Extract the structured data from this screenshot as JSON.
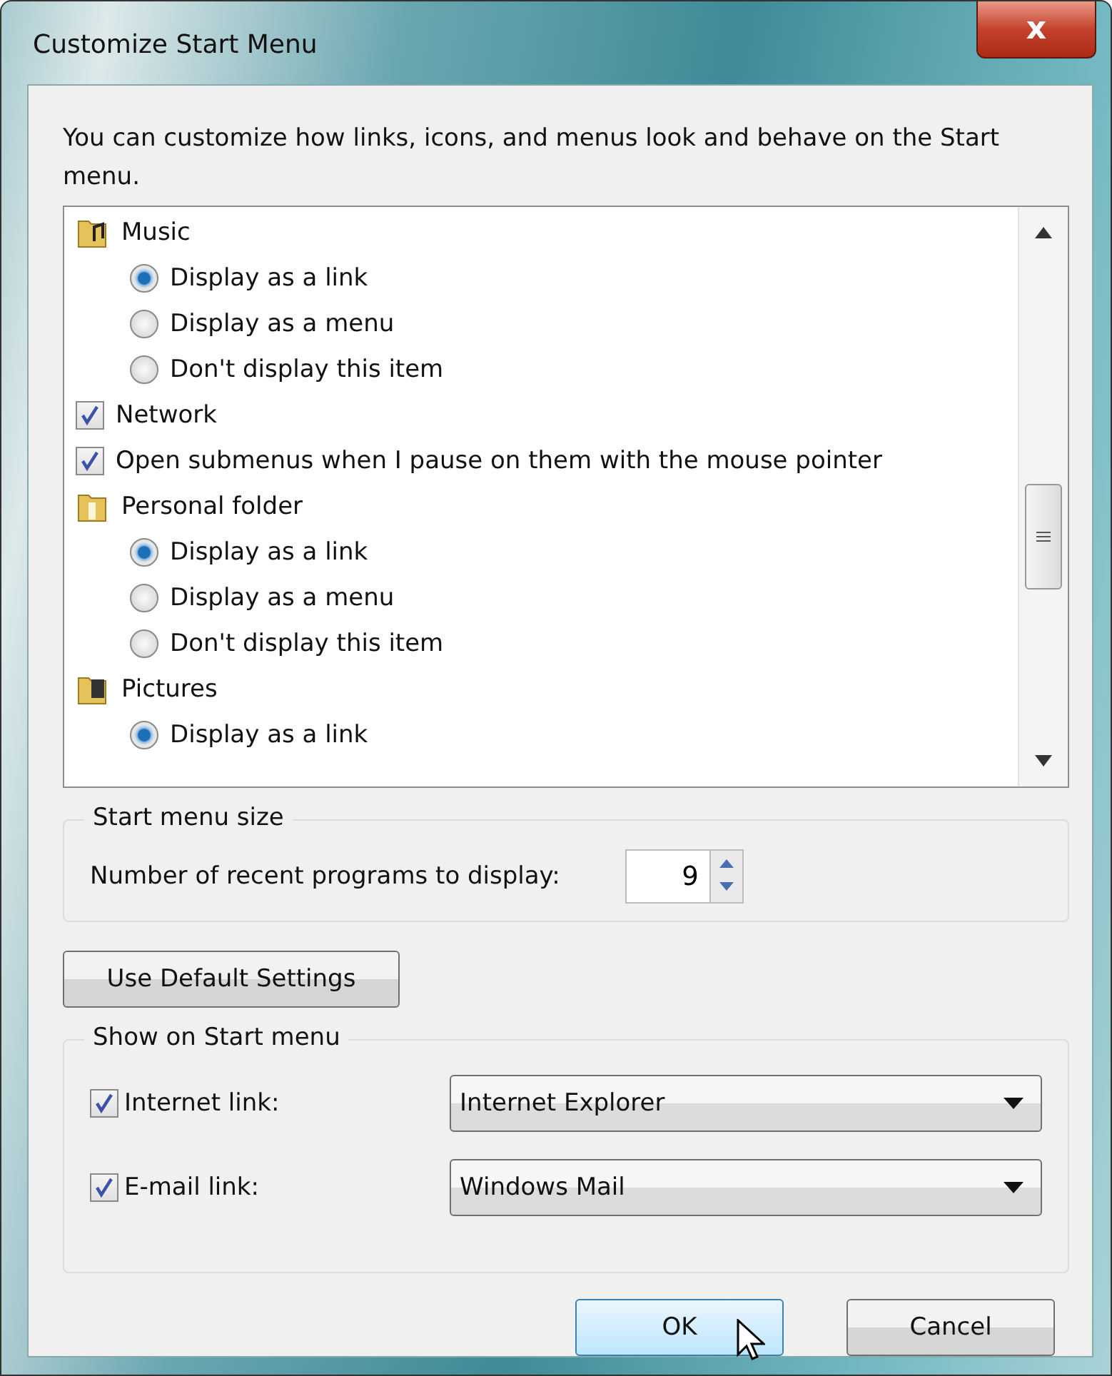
{
  "window": {
    "title": "Customize Start Menu",
    "close": "x"
  },
  "intro": "You can customize how links, icons, and menus look and behave on the Start menu.",
  "options": [
    {
      "kind": "folder",
      "label": "Music"
    },
    {
      "kind": "radio",
      "label": "Display as a link",
      "selected": true
    },
    {
      "kind": "radio",
      "label": "Display as a menu",
      "selected": false
    },
    {
      "kind": "radio",
      "label": "Don't display this item",
      "selected": false
    },
    {
      "kind": "checkbox",
      "label": "Network",
      "checked": true
    },
    {
      "kind": "checkbox",
      "label": "Open submenus when I pause on them with the mouse pointer",
      "checked": true
    },
    {
      "kind": "folder",
      "label": "Personal folder"
    },
    {
      "kind": "radio",
      "label": "Display as a link",
      "selected": true
    },
    {
      "kind": "radio",
      "label": "Display as a menu",
      "selected": false
    },
    {
      "kind": "radio",
      "label": "Don't display this item",
      "selected": false
    },
    {
      "kind": "folder",
      "label": "Pictures"
    },
    {
      "kind": "radio",
      "label": "Display as a link",
      "selected": true
    }
  ],
  "start_menu_size": {
    "title": "Start menu size",
    "label": "Number of recent programs to display:",
    "value": "9"
  },
  "default_button": "Use Default Settings",
  "show_on_start": {
    "title": "Show on Start menu",
    "items": [
      {
        "label": "Internet link:",
        "checked": true,
        "value": "Internet Explorer"
      },
      {
        "label": "E-mail link:",
        "checked": true,
        "value": "Windows Mail"
      }
    ]
  },
  "buttons": [
    {
      "label": "OK",
      "default": true
    },
    {
      "label": "Cancel",
      "default": false
    }
  ]
}
